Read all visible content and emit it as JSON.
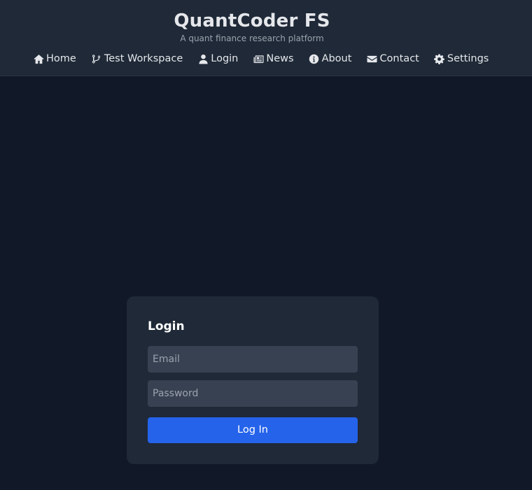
{
  "brand": {
    "title": "QuantCoder FS",
    "subtitle": "A quant finance research platform"
  },
  "nav": {
    "items": [
      {
        "label": "Home",
        "icon": "home-icon"
      },
      {
        "label": "Test Workspace",
        "icon": "code-branch-icon"
      },
      {
        "label": "Login",
        "icon": "user-icon"
      },
      {
        "label": "News",
        "icon": "newspaper-icon"
      },
      {
        "label": "About",
        "icon": "info-circle-icon"
      },
      {
        "label": "Contact",
        "icon": "envelope-icon"
      },
      {
        "label": "Settings",
        "icon": "gear-icon"
      }
    ]
  },
  "login": {
    "title": "Login",
    "email_placeholder": "Email",
    "email_value": "",
    "password_placeholder": "Password",
    "password_value": "",
    "submit_label": "Log In"
  },
  "colors": {
    "background": "#111827",
    "panel": "#1f2937",
    "input": "#374151",
    "accent": "#2563eb"
  }
}
